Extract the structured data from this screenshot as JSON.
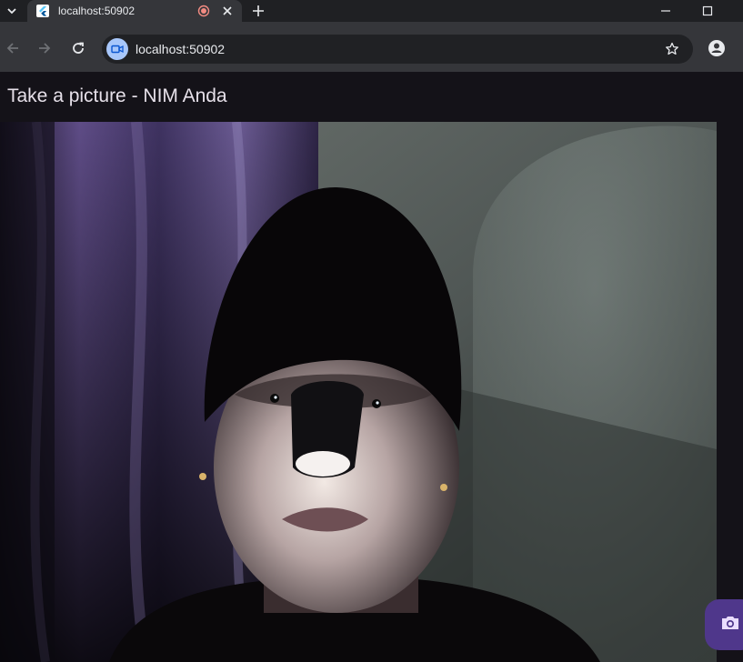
{
  "browser": {
    "tab": {
      "title": "localhost:50902",
      "favicon": "flutter-logo",
      "recording_indicator": "record-icon",
      "close_icon": "close-icon"
    },
    "new_tab_icon": "plus-icon",
    "window_controls": [
      "minimize-icon",
      "maximize-icon"
    ],
    "toolbar": {
      "back_icon": "arrow-left-icon",
      "forward_icon": "arrow-right-icon",
      "reload_icon": "reload-icon",
      "address": "localhost:50902",
      "site_info_icon": "video-camera-icon",
      "bookmark_icon": "star-icon",
      "profile_icon": "person-icon"
    }
  },
  "app": {
    "title": "Take a picture - NIM Anda",
    "camera_preview": "webcam-preview-image",
    "capture_button_icon": "camera-icon"
  },
  "colors": {
    "app_background": "#141218",
    "fab_background": "#4f378b",
    "title_text": "#e6e0e9"
  }
}
